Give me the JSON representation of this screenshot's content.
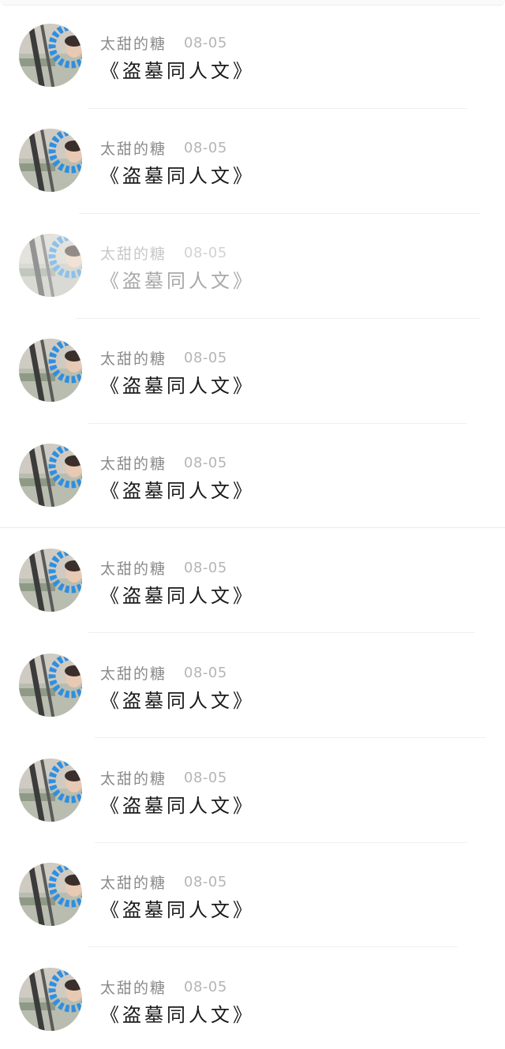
{
  "feed": {
    "items": [
      {
        "author": "太甜的糖",
        "date": "08-05",
        "title": "《盗墓同人文》"
      },
      {
        "author": "太甜的糖",
        "date": "08-05",
        "title": "《盗墓同人文》"
      },
      {
        "author": "太甜的糖",
        "date": "08-05",
        "title": "《盗墓同人文》"
      },
      {
        "author": "太甜的糖",
        "date": "08-05",
        "title": "《盗墓同人文》"
      },
      {
        "author": "太甜的糖",
        "date": "08-05",
        "title": "《盗墓同人文》"
      },
      {
        "author": "太甜的糖",
        "date": "08-05",
        "title": "《盗墓同人文》"
      },
      {
        "author": "太甜的糖",
        "date": "08-05",
        "title": "《盗墓同人文》"
      },
      {
        "author": "太甜的糖",
        "date": "08-05",
        "title": "《盗墓同人文》"
      },
      {
        "author": "太甜的糖",
        "date": "08-05",
        "title": "《盗墓同人文》"
      },
      {
        "author": "太甜的糖",
        "date": "08-05",
        "title": "《盗墓同人文》"
      }
    ]
  },
  "colors": {
    "author": "#8a8a8a",
    "date": "#b5b5b5",
    "title": "#1a1a1a",
    "avatar_ring": "#2f8fe0"
  }
}
